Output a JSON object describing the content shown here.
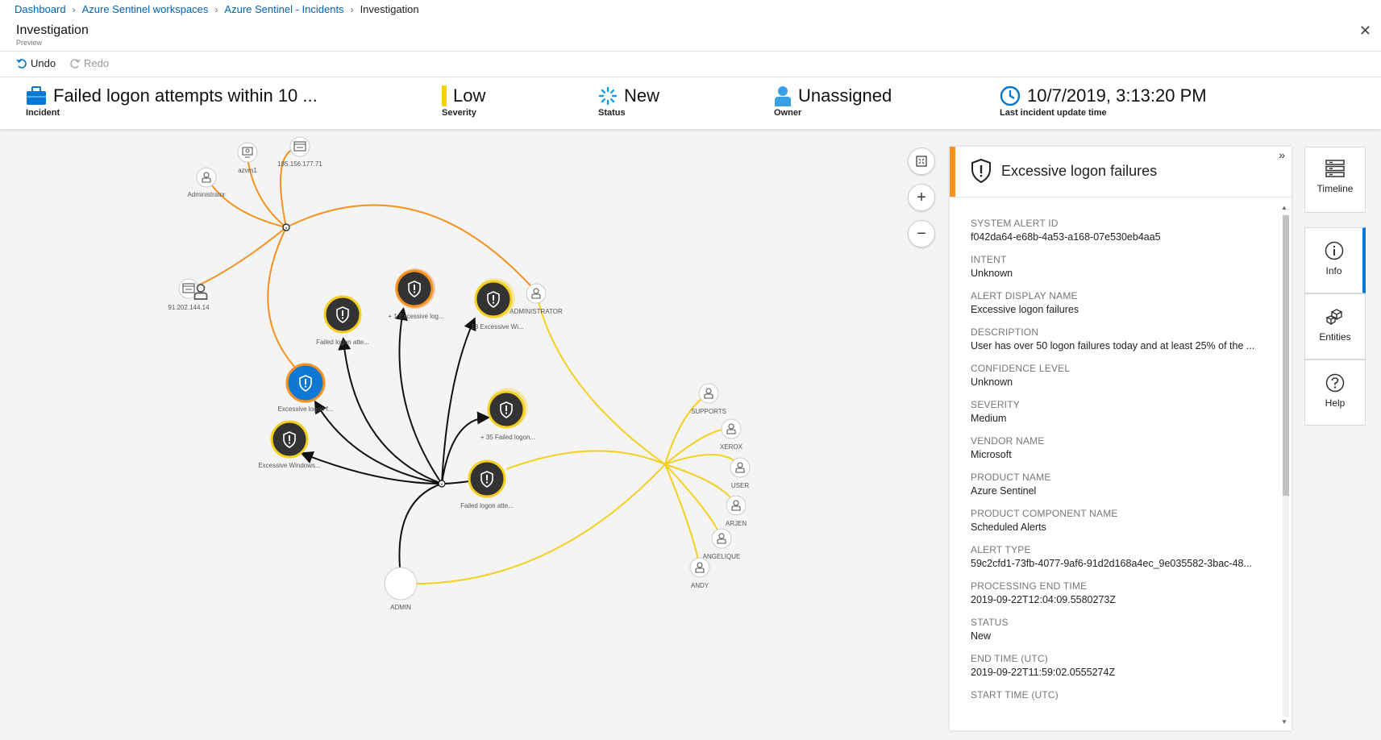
{
  "breadcrumb": [
    {
      "label": "Dashboard",
      "link": true
    },
    {
      "label": "Azure Sentinel workspaces",
      "link": true
    },
    {
      "label": "Azure Sentinel - Incidents",
      "link": true
    },
    {
      "label": "Investigation",
      "link": false
    }
  ],
  "header": {
    "title": "Investigation",
    "subtitle": "Preview"
  },
  "toolbar": {
    "undo": "Undo",
    "redo": "Redo"
  },
  "summary": {
    "incident": {
      "value": "Failed logon attempts within 10 ...",
      "label": "Incident"
    },
    "severity": {
      "value": "Low",
      "label": "Severity",
      "color": "#f5d20a"
    },
    "status": {
      "value": "New",
      "label": "Status"
    },
    "owner": {
      "value": "Unassigned",
      "label": "Owner"
    },
    "time": {
      "value": "10/7/2019, 3:13:20 PM",
      "label": "Last incident update time"
    }
  },
  "graph": {
    "labels": {
      "admin_tl": "Administrator",
      "azvm": "azvm1",
      "ip1": "185.156.177.71",
      "ip2": "91.202.144.14",
      "administrator": "ADMINISTRATOR",
      "alert_failed1": "Failed logon atte...",
      "alert_excessive_log": "+ 1 Excessive log...",
      "alert_13": "13 Excessive Wi...",
      "alert_excessive_f": "Excessive logon f...",
      "alert_35": "+ 35 Failed logon...",
      "alert_excessive_win": "Excessive Windows...",
      "alert_failed2": "Failed logon atte...",
      "admin": "ADMIN",
      "supports": "SUPPORTS",
      "xerox": "XEROX",
      "user": "USER",
      "arjen": "ARJEN",
      "angelique": "ANGELIQUE",
      "andy": "ANDY"
    },
    "colors": {
      "orange": "#f7921e",
      "yellow": "#f5cf1e",
      "black": "#111111",
      "selected": "#0e78d4"
    }
  },
  "panel": {
    "title": "Excessive logon failures",
    "accent": "#f7921e",
    "fields": [
      {
        "label": "SYSTEM ALERT ID",
        "value": "f042da64-e68b-4a53-a168-07e530eb4aa5"
      },
      {
        "label": "INTENT",
        "value": "Unknown"
      },
      {
        "label": "ALERT DISPLAY NAME",
        "value": "Excessive logon failures"
      },
      {
        "label": "DESCRIPTION",
        "value": "User has over 50 logon failures today and at least 25% of the ..."
      },
      {
        "label": "CONFIDENCE LEVEL",
        "value": "Unknown"
      },
      {
        "label": "SEVERITY",
        "value": "Medium"
      },
      {
        "label": "VENDOR NAME",
        "value": "Microsoft"
      },
      {
        "label": "PRODUCT NAME",
        "value": "Azure Sentinel"
      },
      {
        "label": "PRODUCT COMPONENT NAME",
        "value": "Scheduled Alerts"
      },
      {
        "label": "ALERT TYPE",
        "value": "59c2cfd1-73fb-4077-9af6-91d2d168a4ec_9e035582-3bac-48..."
      },
      {
        "label": "PROCESSING END TIME",
        "value": "2019-09-22T12:04:09.5580273Z"
      },
      {
        "label": "STATUS",
        "value": "New"
      },
      {
        "label": "END TIME (UTC)",
        "value": "2019-09-22T11:59:02.0555274Z"
      },
      {
        "label": "START TIME (UTC)",
        "value": ""
      }
    ]
  },
  "sidebar": [
    {
      "label": "Timeline",
      "icon": "timeline-icon"
    },
    {
      "label": "Info",
      "icon": "info-icon"
    },
    {
      "label": "Entities",
      "icon": "entities-icon"
    },
    {
      "label": "Help",
      "icon": "help-icon"
    }
  ]
}
